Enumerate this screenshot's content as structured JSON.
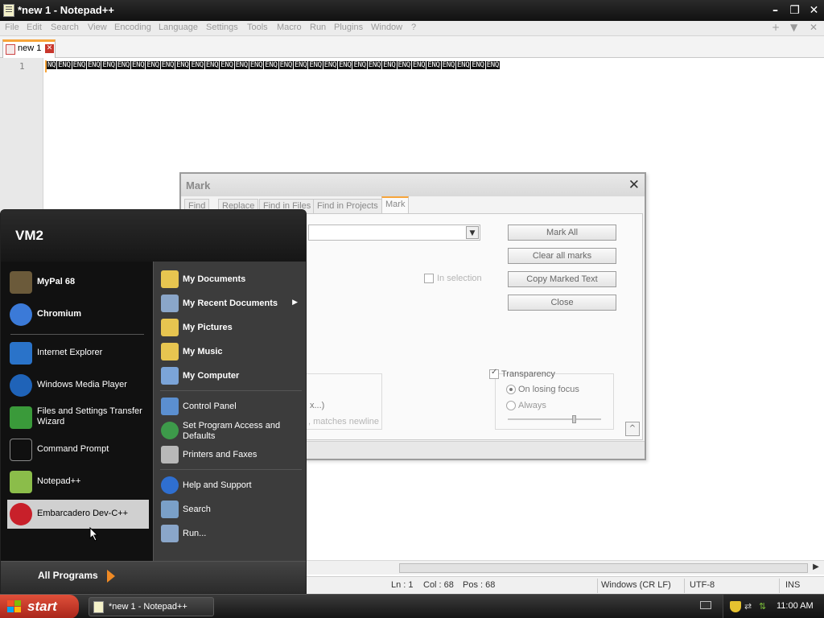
{
  "titlebar": {
    "title": "*new 1 - Notepad++"
  },
  "menu": [
    "File",
    "Edit",
    "Search",
    "View",
    "Encoding",
    "Language",
    "Settings",
    "Tools",
    "Macro",
    "Run",
    "Plugins",
    "Window",
    "?"
  ],
  "menu_right": [
    "+",
    "▼",
    "✕"
  ],
  "tab": {
    "label": "new 1"
  },
  "editor": {
    "line_number": "1",
    "first_token": "NQ",
    "token": "ENQ",
    "token_repeat": 30
  },
  "status": {
    "ln": "Ln : 1",
    "col": "Col : 68",
    "pos": "Pos : 68",
    "eol": "Windows (CR LF)",
    "encoding": "UTF-8",
    "mode": "INS"
  },
  "dialog": {
    "title": "Mark",
    "tabs": [
      "Find",
      "Replace",
      "Find in Files",
      "Find in Projects",
      "Mark"
    ],
    "buttons": {
      "mark_all": "Mark All",
      "clear_all": "Clear all marks",
      "copy_marked": "Copy Marked Text",
      "close": "Close"
    },
    "in_selection": "In selection",
    "transparency": "Transparency",
    "on_losing_focus": "On losing focus",
    "always": "Always",
    "partial_text_1": "x...)",
    "partial_text_2": ", matches newline",
    "small_btn": "^"
  },
  "start_menu": {
    "user": "VM2",
    "left_items": [
      {
        "label": "MyPal 68",
        "bold": true,
        "color": "#6b5a3a"
      },
      {
        "label": "Chromium",
        "bold": true,
        "color": "#3b7ad8"
      },
      {
        "label": "Internet Explorer",
        "bold": false,
        "color": "#2a73c9"
      },
      {
        "label": "Windows Media Player",
        "bold": false,
        "color": "#1f63b8"
      },
      {
        "label": "Files and Settings Transfer Wizard",
        "bold": false,
        "color": "#3a9a3a"
      },
      {
        "label": "Command Prompt",
        "bold": false,
        "color": "#101010"
      },
      {
        "label": "Notepad++",
        "bold": false,
        "color": "#8bbd4a"
      },
      {
        "label": "Embarcadero Dev-C++",
        "bold": false,
        "color": "#c8202a"
      }
    ],
    "right_items": [
      {
        "label": "My Documents",
        "bold": true,
        "color": "#e7c550"
      },
      {
        "label": "My Recent Documents",
        "bold": true,
        "color": "#8aa6c9"
      },
      {
        "label": "My Pictures",
        "bold": true,
        "color": "#e7c550"
      },
      {
        "label": "My Music",
        "bold": true,
        "color": "#e7c550"
      },
      {
        "label": "My Computer",
        "bold": true,
        "color": "#7ba4d8"
      },
      {
        "label": "Control Panel",
        "bold": false,
        "color": "#5b8fd0"
      },
      {
        "label": "Set Program Access and Defaults",
        "bold": false,
        "color": "#3d9a4a"
      },
      {
        "label": "Printers and Faxes",
        "bold": false,
        "color": "#b8b8b8"
      },
      {
        "label": "Help and Support",
        "bold": false,
        "color": "#2f6fd0"
      },
      {
        "label": "Search",
        "bold": false,
        "color": "#7aa0c8"
      },
      {
        "label": "Run...",
        "bold": false,
        "color": "#8aa6c9"
      }
    ],
    "all_programs": "All Programs"
  },
  "taskbar": {
    "start": "start",
    "task": "*new 1 - Notepad++",
    "clock": "11:00 AM"
  }
}
